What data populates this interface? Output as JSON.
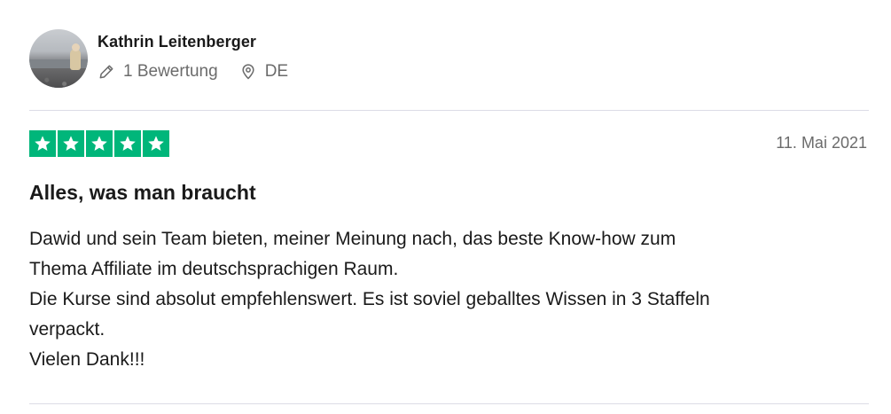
{
  "reviewer": {
    "name": "Kathrin Leitenberger",
    "review_count": "1 Bewertung",
    "country": "DE"
  },
  "review": {
    "rating": 5,
    "rating_max": 5,
    "star_color": "#00b67a",
    "date": "11. Mai 2021",
    "title": "Alles, was man braucht",
    "body_lines": [
      "Dawid und sein Team bieten, meiner Meinung nach, das beste Know-how zum",
      "Thema Affiliate im deutschsprachigen Raum.",
      "Die Kurse sind absolut empfehlenswert. Es ist soviel geballtes Wissen in 3 Staffeln",
      "verpackt.",
      "Vielen Dank!!!"
    ]
  },
  "icons": {
    "review_count": "pencil-icon",
    "country": "location-pin-icon",
    "rating": "star-icon"
  }
}
